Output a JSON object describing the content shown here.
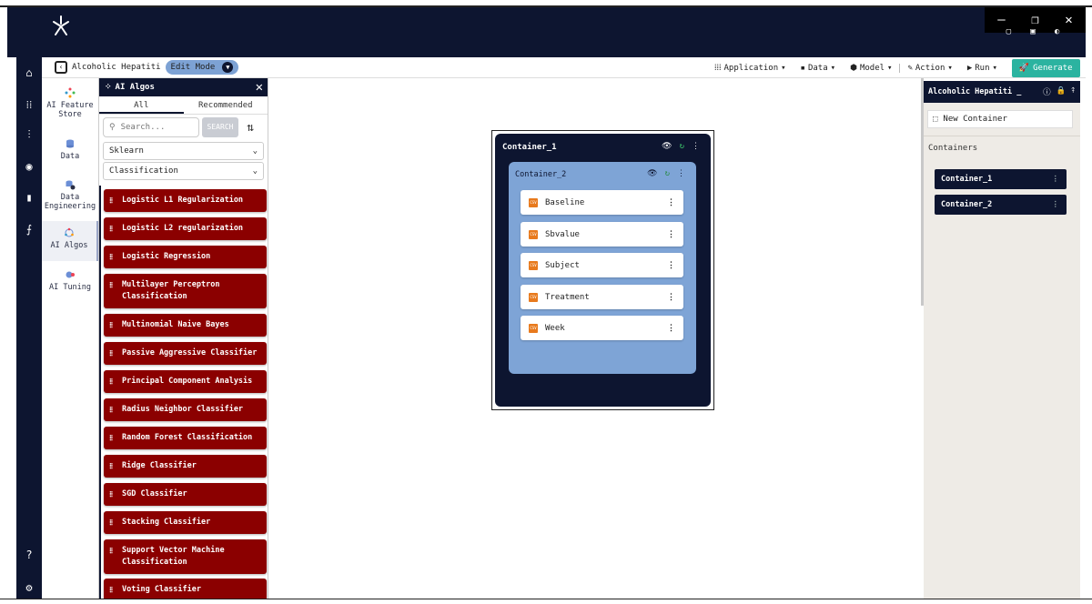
{
  "window": {
    "minimize": "—",
    "restore": "❐",
    "close": "✕"
  },
  "toolbar": {
    "project_title": "Alcoholic Hepatiti",
    "mode": "Edit Mode",
    "menus": [
      {
        "label": "Application"
      },
      {
        "label": "Data"
      },
      {
        "label": "Model"
      },
      {
        "label": "Action"
      },
      {
        "label": "Run"
      }
    ],
    "generate_label": "Generate"
  },
  "feature_nav": [
    {
      "label": "AI Feature Store",
      "icon": "feature-store-icon"
    },
    {
      "label": "Data",
      "icon": "database-icon"
    },
    {
      "label": "Data Engineering",
      "icon": "data-engineering-icon"
    },
    {
      "label": "AI Algos",
      "icon": "ai-algos-icon",
      "active": true
    },
    {
      "label": "AI Tuning",
      "icon": "ai-tuning-icon"
    }
  ],
  "algo_panel": {
    "title": "AI Algos",
    "tabs": [
      "All",
      "Recommended"
    ],
    "active_tab": "All",
    "search_placeholder": "Search...",
    "search_button": "SEARCH",
    "library": "Sklearn",
    "task": "Classification",
    "items": [
      "Logistic L1 Regularization",
      "Logistic L2 regularization",
      "Logistic Regression",
      "Multilayer Perceptron Classification",
      "Multinomial Naive Bayes",
      "Passive Aggressive Classifier",
      "Principal Component Analysis",
      "Radius Neighbor Classifier",
      "Random Forest Classification",
      "Ridge Classifier",
      "SGD Classifier",
      "Stacking Classifier",
      "Support Vector Machine Classification",
      "Voting Classifier"
    ]
  },
  "canvas": {
    "container1": {
      "title": "Container_1"
    },
    "container2": {
      "title": "Container_2",
      "fields": [
        "Baseline",
        "Sbvalue",
        "Subject",
        "Treatment",
        "Week"
      ]
    }
  },
  "right_panel": {
    "title": "Alcoholic Hepatiti _",
    "new_container": "New Container",
    "section_label": "Containers",
    "containers": [
      "Container_1",
      "Container_2"
    ]
  },
  "colors": {
    "navy": "#0d1530",
    "algo_red": "#8b0000",
    "container2_blue": "#7ea4d6",
    "generate_teal": "#2bb3a0"
  }
}
